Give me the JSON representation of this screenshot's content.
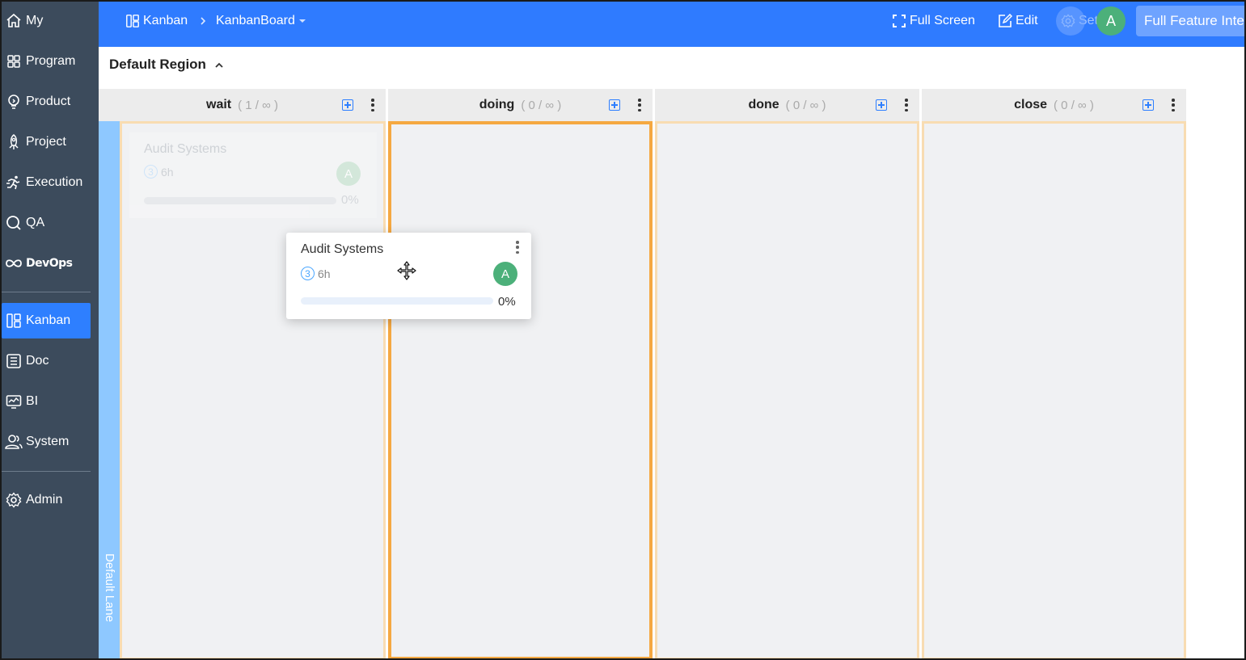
{
  "sidebar": {
    "items": [
      {
        "label": "My",
        "icon": "home-icon"
      },
      {
        "label": "Program",
        "icon": "grid-icon"
      },
      {
        "label": "Product",
        "icon": "bulb-icon"
      },
      {
        "label": "Project",
        "icon": "rocket-icon"
      },
      {
        "label": "Execution",
        "icon": "runner-icon"
      },
      {
        "label": "QA",
        "icon": "search-icon"
      },
      {
        "label": "DevOps",
        "icon": "infinity-icon"
      },
      {
        "label": "Kanban",
        "icon": "kanban-icon",
        "active": true
      },
      {
        "label": "Doc",
        "icon": "document-icon"
      },
      {
        "label": "BI",
        "icon": "monitor-icon"
      },
      {
        "label": "System",
        "icon": "users-icon"
      },
      {
        "label": "Admin",
        "icon": "gear-icon"
      }
    ]
  },
  "header": {
    "breadcrumb_root": "Kanban",
    "breadcrumb_current": "KanbanBoard",
    "fullscreen_label": "Full Screen",
    "edit_label": "Edit",
    "settings_label": "Setti",
    "avatar_letter": "A",
    "feature_button_label": "Full Feature Inte"
  },
  "region": {
    "title": "Default Region"
  },
  "lane": {
    "name": "Default Lane"
  },
  "columns": [
    {
      "name": "wait",
      "limit": "( 1 / ∞ )"
    },
    {
      "name": "doing",
      "limit": "( 0 / ∞ )"
    },
    {
      "name": "done",
      "limit": "( 0 / ∞ )"
    },
    {
      "name": "close",
      "limit": "( 0 / ∞ )"
    }
  ],
  "card": {
    "title": "Audit Systems",
    "priority": "3",
    "estimate": "6h",
    "assignee": "A",
    "progress_text": "0%",
    "progress": 0
  },
  "colors": {
    "accent": "#2f7bff",
    "sidebar": "#3c4b5c",
    "drop_target": "#f5a841",
    "avatar": "#4cb07a"
  }
}
